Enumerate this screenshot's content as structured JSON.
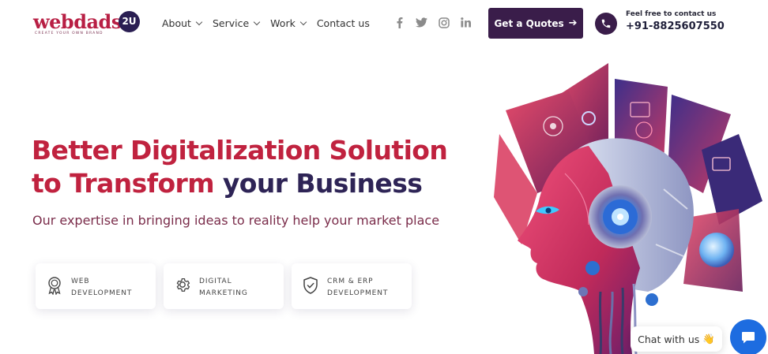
{
  "logo": {
    "word": "webdads",
    "badge": "2U",
    "tagline": "CREATE YOUR OWN BRAND"
  },
  "nav": [
    {
      "label": "About",
      "has_dropdown": true
    },
    {
      "label": "Service",
      "has_dropdown": true
    },
    {
      "label": "Work",
      "has_dropdown": true
    },
    {
      "label": "Contact us",
      "has_dropdown": false
    }
  ],
  "social": [
    "facebook-icon",
    "twitter-icon",
    "instagram-icon",
    "linkedin-icon"
  ],
  "cta": {
    "label": "Get a Quotes",
    "icon": "arrow-right-icon"
  },
  "contact": {
    "label": "Feel free to contact us",
    "phone": "+91-8825607550"
  },
  "hero": {
    "title_line1": "Better Digitalization Solution",
    "title_line2_accent": "to Transform",
    "title_line2_rest": "your Business",
    "subtitle": "Our expertise in bringing ideas to reality help your market place"
  },
  "services": [
    {
      "line1": "WEB",
      "line2": "DEVELOPMENT",
      "icon": "award-ribbon-icon"
    },
    {
      "line1": "DIGITAL",
      "line2": "MARKETING",
      "icon": "gear-icon"
    },
    {
      "line1": "CRM & ERP",
      "line2": "DEVELOPMENT",
      "icon": "shield-check-icon"
    }
  ],
  "chat": {
    "label": "Chat with us",
    "emoji": "👋"
  },
  "colors": {
    "brand_red": "#c0223f",
    "brand_purple": "#3a1d4a",
    "chat_blue": "#1d6ce0"
  }
}
